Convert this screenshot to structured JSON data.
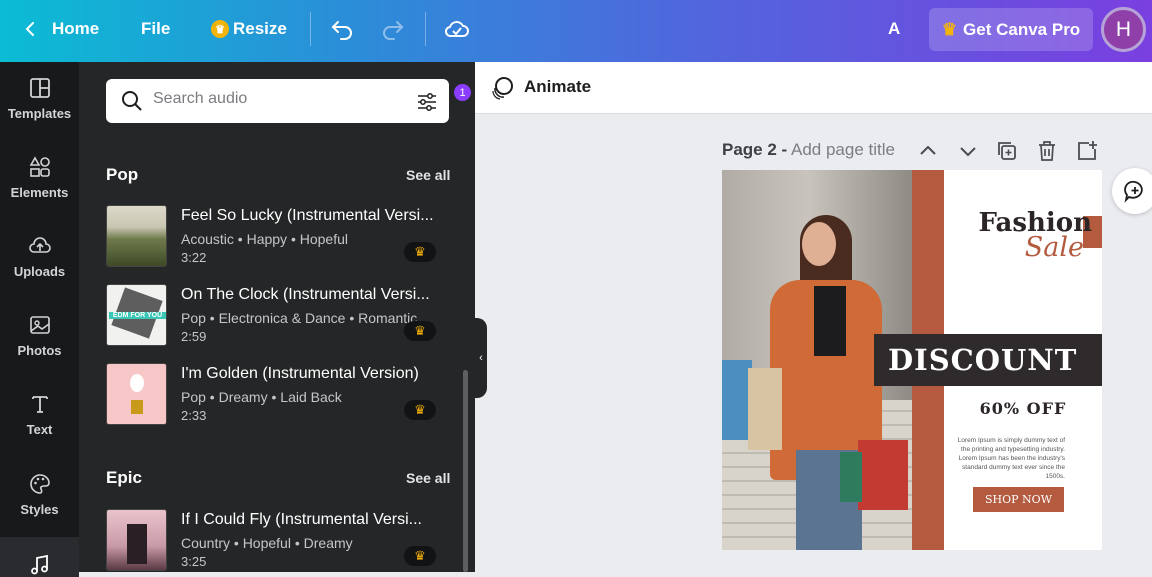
{
  "topbar": {
    "home": "Home",
    "file": "File",
    "resize": "Resize",
    "text_a": "A",
    "pro_label": "Get Canva Pro",
    "avatar_initial": "H"
  },
  "rail": {
    "items": [
      {
        "label": "Templates",
        "icon": "templates-icon"
      },
      {
        "label": "Elements",
        "icon": "elements-icon"
      },
      {
        "label": "Uploads",
        "icon": "uploads-icon"
      },
      {
        "label": "Photos",
        "icon": "photos-icon"
      },
      {
        "label": "Text",
        "icon": "text-icon"
      },
      {
        "label": "Styles",
        "icon": "styles-icon"
      },
      {
        "label": "",
        "icon": "audio-icon"
      }
    ]
  },
  "panel": {
    "search_placeholder": "Search audio",
    "filter_count": "1",
    "sections": [
      {
        "title": "Pop",
        "see_all": "See all",
        "tracks": [
          {
            "title": "Feel So Lucky (Instrumental Versi...",
            "tags": "Acoustic • Happy • Hopeful",
            "duration": "3:22"
          },
          {
            "title": "On The Clock (Instrumental Versi...",
            "tags": "Pop • Electronica & Dance • Romantic",
            "duration": "2:59"
          },
          {
            "title": "I'm Golden (Instrumental Version)",
            "tags": "Pop • Dreamy • Laid Back",
            "duration": "2:33"
          }
        ]
      },
      {
        "title": "Epic",
        "see_all": "See all",
        "tracks": [
          {
            "title": "If I Could Fly (Instrumental Versi...",
            "tags": "Country • Hopeful • Dreamy",
            "duration": "3:25"
          }
        ]
      }
    ],
    "thumb_text": "EDM FOR YOU"
  },
  "canvas": {
    "animate": "Animate",
    "page_label": "Page 2 -",
    "page_title_placeholder": "Add page title"
  },
  "design": {
    "fashion": "Fashion",
    "sale": "Sale",
    "discount": "DISCOUNT",
    "off": "60% OFF",
    "lorem": "Lorem Ipsum is simply dummy text of the printing and typesetting industry. Lorem Ipsum has been the industry's standard dummy text ever since the 1500s.",
    "shop_now": "SHOP NOW"
  },
  "colors": {
    "accent": "#8b3dff",
    "crown": "#f5b40a",
    "brand_rust": "#b35a3f"
  }
}
